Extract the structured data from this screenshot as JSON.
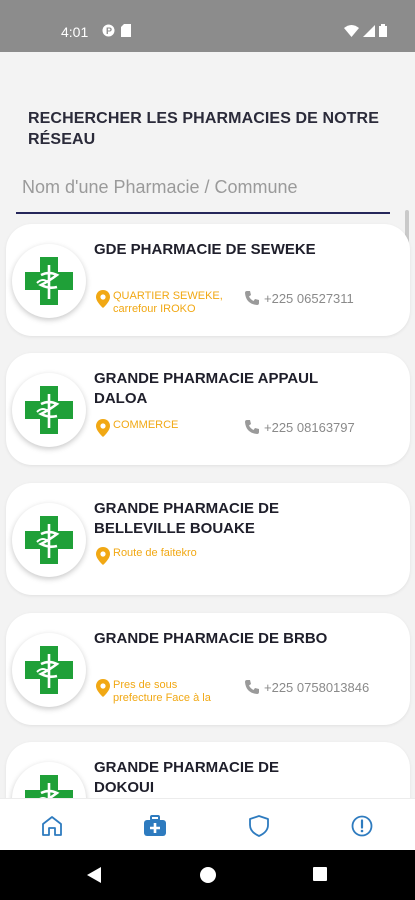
{
  "status": {
    "time": "4:01"
  },
  "header": {
    "title": "RECHERCHER LES PHARMACIES DE NOTRE RÉSEAU"
  },
  "search": {
    "placeholder": "Nom d'une Pharmacie / Commune"
  },
  "pharmacies": [
    {
      "name": "GDE PHARMACIE DE SEWEKE",
      "address": "QUARTIER SEWEKE, carrefour IROKO",
      "phone": "+225 06527311"
    },
    {
      "name": "GRANDE PHARMACIE APPAUL DALOA",
      "address": "COMMERCE",
      "phone": "+225 08163797"
    },
    {
      "name": "GRANDE PHARMACIE DE BELLEVILLE BOUAKE",
      "address": "Route de faitekro",
      "phone": ""
    },
    {
      "name": "GRANDE PHARMACIE DE BRBO",
      "address": "Pres de sous prefecture Face à la",
      "phone": "+225 0758013846"
    },
    {
      "name": "GRANDE PHARMACIE DE DOKOUI",
      "address": "",
      "phone": ""
    }
  ],
  "nav": {
    "items": [
      "home-icon",
      "medical-kit-icon",
      "shield-icon",
      "info-icon"
    ],
    "active_index": 1
  },
  "colors": {
    "accent": "#2e7bbf",
    "address": "#f1a814",
    "cross": "#1fa038",
    "title": "#25265a"
  }
}
